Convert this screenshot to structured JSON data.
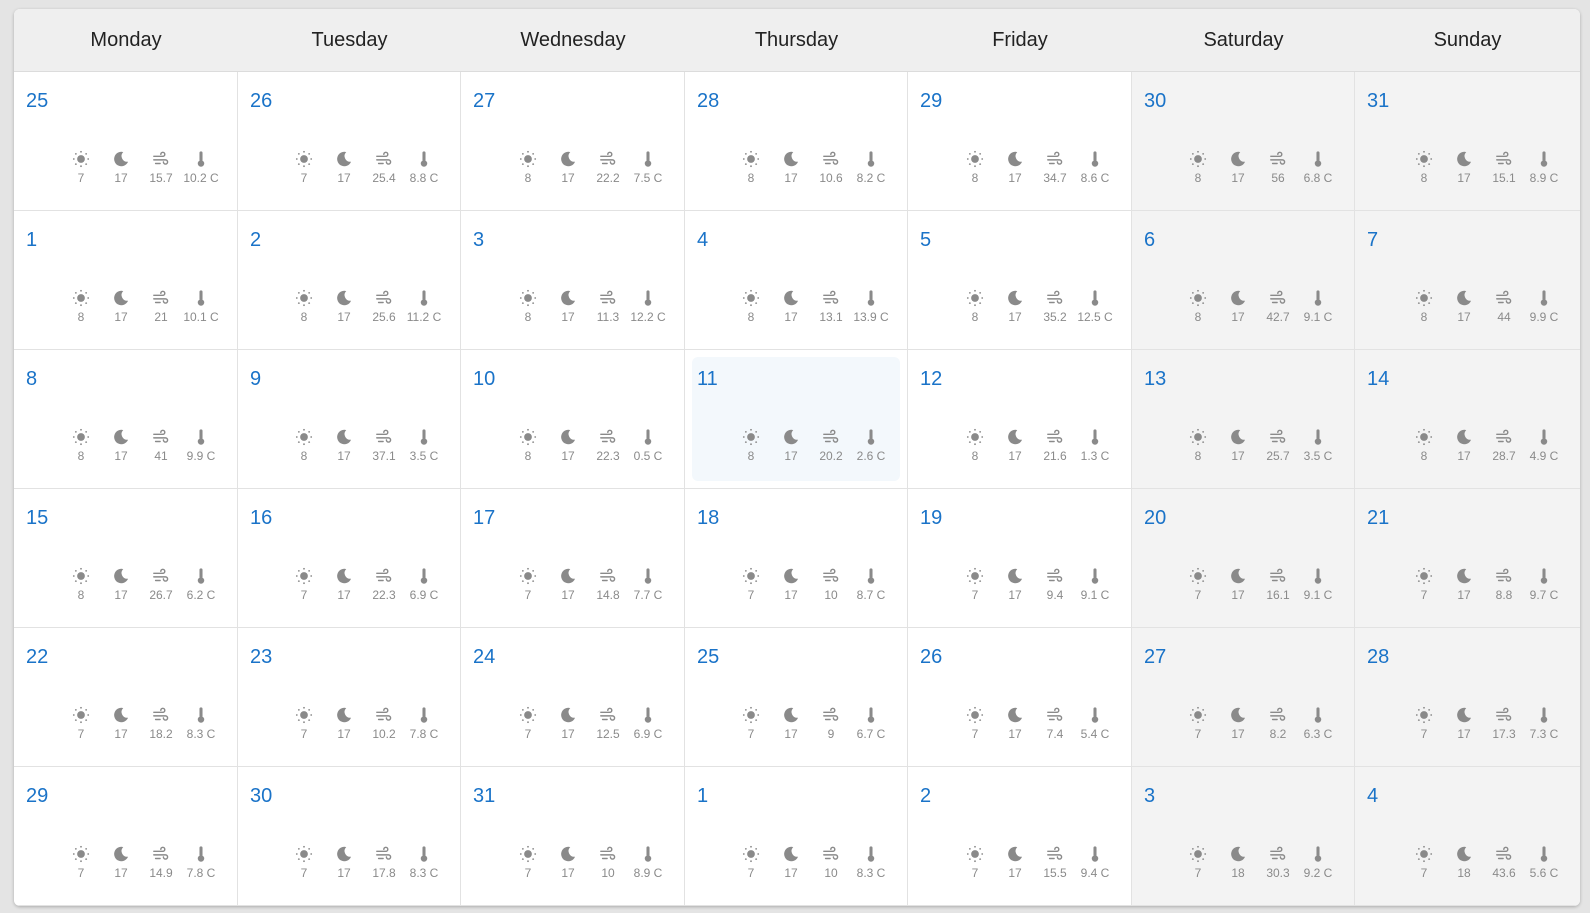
{
  "colors": {
    "accent": "#1a73c8",
    "icon": "#8a8a8a",
    "today_bg": "#f3f8fc",
    "weekend_bg": "#f3f3f3"
  },
  "icons": [
    "sun-icon",
    "moon-icon",
    "wind-icon",
    "thermometer-icon"
  ],
  "weekdays": [
    "Monday",
    "Tuesday",
    "Wednesday",
    "Thursday",
    "Friday",
    "Saturday",
    "Sunday"
  ],
  "today_index": 17,
  "days": [
    {
      "day": "25",
      "sun": "7",
      "moon": "17",
      "wind": "15.7",
      "temp": "10.2 C"
    },
    {
      "day": "26",
      "sun": "7",
      "moon": "17",
      "wind": "25.4",
      "temp": "8.8 C"
    },
    {
      "day": "27",
      "sun": "8",
      "moon": "17",
      "wind": "22.2",
      "temp": "7.5 C"
    },
    {
      "day": "28",
      "sun": "8",
      "moon": "17",
      "wind": "10.6",
      "temp": "8.2 C"
    },
    {
      "day": "29",
      "sun": "8",
      "moon": "17",
      "wind": "34.7",
      "temp": "8.6 C"
    },
    {
      "day": "30",
      "sun": "8",
      "moon": "17",
      "wind": "56",
      "temp": "6.8 C"
    },
    {
      "day": "31",
      "sun": "8",
      "moon": "17",
      "wind": "15.1",
      "temp": "8.9 C"
    },
    {
      "day": "1",
      "sun": "8",
      "moon": "17",
      "wind": "21",
      "temp": "10.1 C"
    },
    {
      "day": "2",
      "sun": "8",
      "moon": "17",
      "wind": "25.6",
      "temp": "11.2 C"
    },
    {
      "day": "3",
      "sun": "8",
      "moon": "17",
      "wind": "11.3",
      "temp": "12.2 C"
    },
    {
      "day": "4",
      "sun": "8",
      "moon": "17",
      "wind": "13.1",
      "temp": "13.9 C"
    },
    {
      "day": "5",
      "sun": "8",
      "moon": "17",
      "wind": "35.2",
      "temp": "12.5 C"
    },
    {
      "day": "6",
      "sun": "8",
      "moon": "17",
      "wind": "42.7",
      "temp": "9.1 C"
    },
    {
      "day": "7",
      "sun": "8",
      "moon": "17",
      "wind": "44",
      "temp": "9.9 C"
    },
    {
      "day": "8",
      "sun": "8",
      "moon": "17",
      "wind": "41",
      "temp": "9.9 C"
    },
    {
      "day": "9",
      "sun": "8",
      "moon": "17",
      "wind": "37.1",
      "temp": "3.5 C"
    },
    {
      "day": "10",
      "sun": "8",
      "moon": "17",
      "wind": "22.3",
      "temp": "0.5 C"
    },
    {
      "day": "11",
      "sun": "8",
      "moon": "17",
      "wind": "20.2",
      "temp": "2.6 C"
    },
    {
      "day": "12",
      "sun": "8",
      "moon": "17",
      "wind": "21.6",
      "temp": "1.3 C"
    },
    {
      "day": "13",
      "sun": "8",
      "moon": "17",
      "wind": "25.7",
      "temp": "3.5 C"
    },
    {
      "day": "14",
      "sun": "8",
      "moon": "17",
      "wind": "28.7",
      "temp": "4.9 C"
    },
    {
      "day": "15",
      "sun": "8",
      "moon": "17",
      "wind": "26.7",
      "temp": "6.2 C"
    },
    {
      "day": "16",
      "sun": "7",
      "moon": "17",
      "wind": "22.3",
      "temp": "6.9 C"
    },
    {
      "day": "17",
      "sun": "7",
      "moon": "17",
      "wind": "14.8",
      "temp": "7.7 C"
    },
    {
      "day": "18",
      "sun": "7",
      "moon": "17",
      "wind": "10",
      "temp": "8.7 C"
    },
    {
      "day": "19",
      "sun": "7",
      "moon": "17",
      "wind": "9.4",
      "temp": "9.1 C"
    },
    {
      "day": "20",
      "sun": "7",
      "moon": "17",
      "wind": "16.1",
      "temp": "9.1 C"
    },
    {
      "day": "21",
      "sun": "7",
      "moon": "17",
      "wind": "8.8",
      "temp": "9.7 C"
    },
    {
      "day": "22",
      "sun": "7",
      "moon": "17",
      "wind": "18.2",
      "temp": "8.3 C"
    },
    {
      "day": "23",
      "sun": "7",
      "moon": "17",
      "wind": "10.2",
      "temp": "7.8 C"
    },
    {
      "day": "24",
      "sun": "7",
      "moon": "17",
      "wind": "12.5",
      "temp": "6.9 C"
    },
    {
      "day": "25",
      "sun": "7",
      "moon": "17",
      "wind": "9",
      "temp": "6.7 C"
    },
    {
      "day": "26",
      "sun": "7",
      "moon": "17",
      "wind": "7.4",
      "temp": "5.4 C"
    },
    {
      "day": "27",
      "sun": "7",
      "moon": "17",
      "wind": "8.2",
      "temp": "6.3 C"
    },
    {
      "day": "28",
      "sun": "7",
      "moon": "17",
      "wind": "17.3",
      "temp": "7.3 C"
    },
    {
      "day": "29",
      "sun": "7",
      "moon": "17",
      "wind": "14.9",
      "temp": "7.8 C"
    },
    {
      "day": "30",
      "sun": "7",
      "moon": "17",
      "wind": "17.8",
      "temp": "8.3 C"
    },
    {
      "day": "31",
      "sun": "7",
      "moon": "17",
      "wind": "10",
      "temp": "8.9 C"
    },
    {
      "day": "1",
      "sun": "7",
      "moon": "17",
      "wind": "10",
      "temp": "8.3 C"
    },
    {
      "day": "2",
      "sun": "7",
      "moon": "17",
      "wind": "15.5",
      "temp": "9.4 C"
    },
    {
      "day": "3",
      "sun": "7",
      "moon": "18",
      "wind": "30.3",
      "temp": "9.2 C"
    },
    {
      "day": "4",
      "sun": "7",
      "moon": "18",
      "wind": "43.6",
      "temp": "5.6 C"
    }
  ]
}
